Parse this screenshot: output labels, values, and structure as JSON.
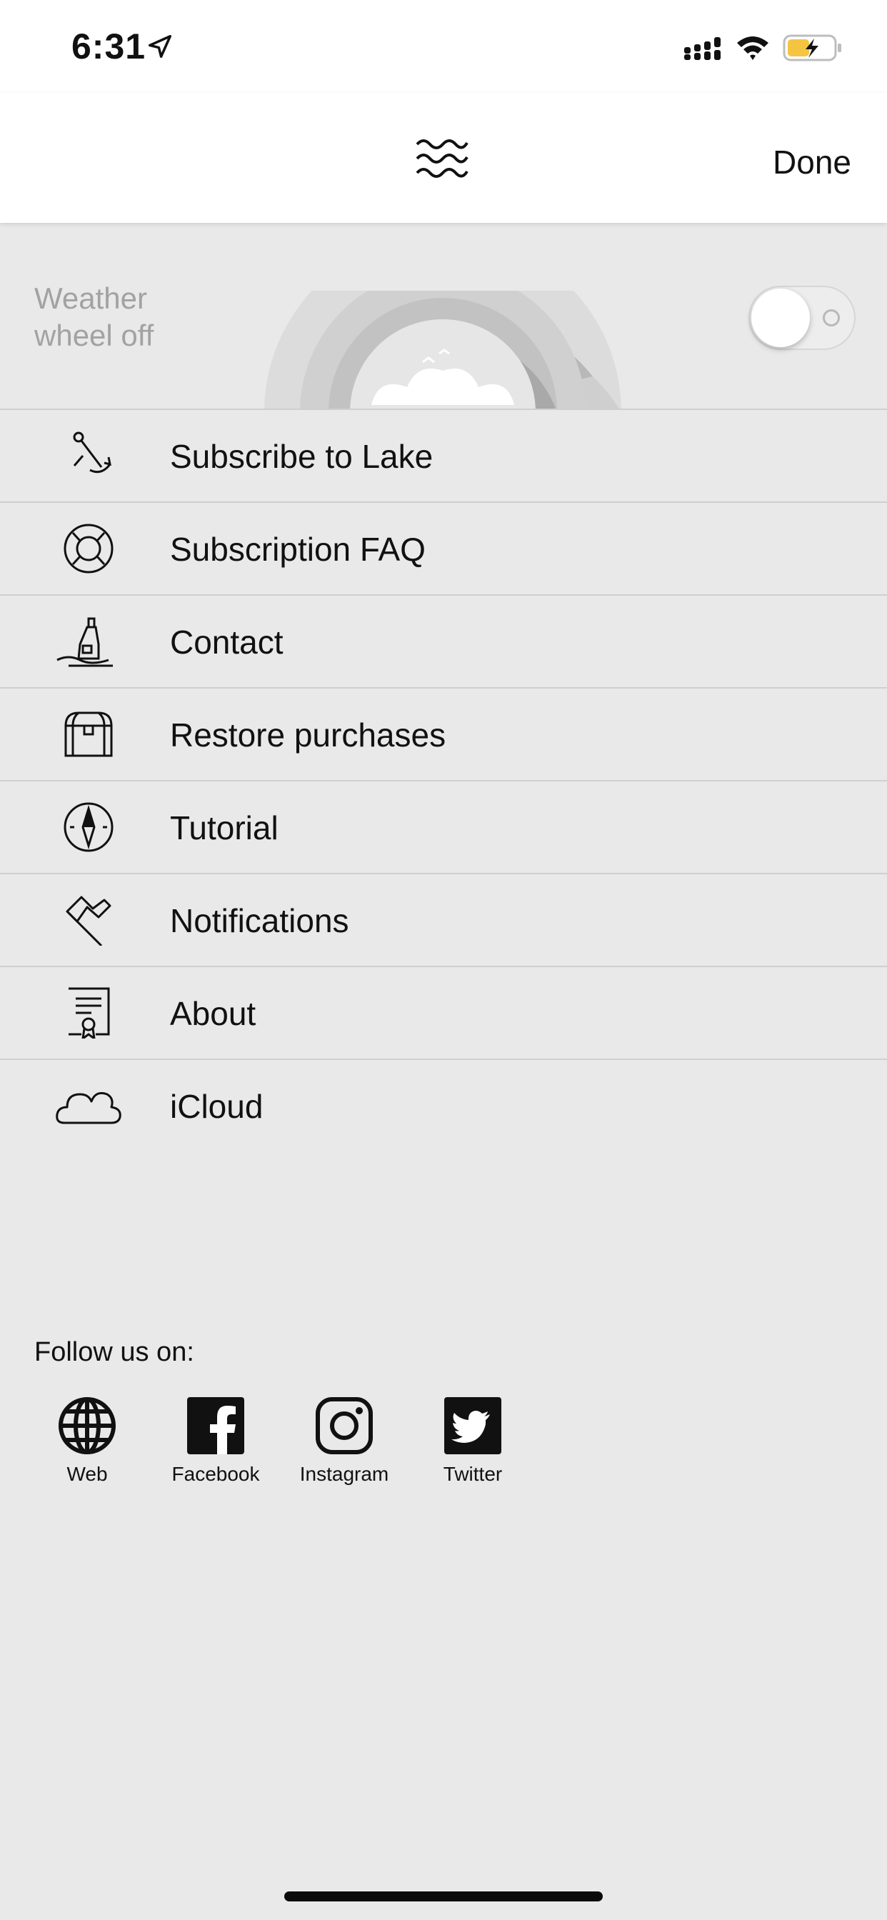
{
  "status_bar": {
    "time": "6:31",
    "icons": [
      "location-arrow-icon",
      "cellular-signal-icon",
      "wifi-icon",
      "battery-charging-icon"
    ],
    "battery_color": "#f5c542"
  },
  "navbar": {
    "logo_icon": "waves-icon",
    "done_label": "Done"
  },
  "weather": {
    "label_line1": "Weather",
    "label_line2": "wheel off",
    "toggle_on": false
  },
  "menu": {
    "items": [
      {
        "label": "Subscribe to Lake",
        "icon": "anchor-icon"
      },
      {
        "label": "Subscription FAQ",
        "icon": "lifebuoy-icon"
      },
      {
        "label": "Contact",
        "icon": "message-in-bottle-icon"
      },
      {
        "label": "Restore purchases",
        "icon": "treasure-chest-icon"
      },
      {
        "label": "Tutorial",
        "icon": "compass-icon"
      },
      {
        "label": "Notifications",
        "icon": "flag-icon"
      },
      {
        "label": "About",
        "icon": "certificate-icon"
      },
      {
        "label": "iCloud",
        "icon": "cloud-icon"
      }
    ]
  },
  "follow": {
    "title": "Follow us on:",
    "links": [
      {
        "label": "Web",
        "icon": "globe-icon"
      },
      {
        "label": "Facebook",
        "icon": "facebook-icon"
      },
      {
        "label": "Instagram",
        "icon": "instagram-icon"
      },
      {
        "label": "Twitter",
        "icon": "twitter-icon"
      }
    ]
  }
}
